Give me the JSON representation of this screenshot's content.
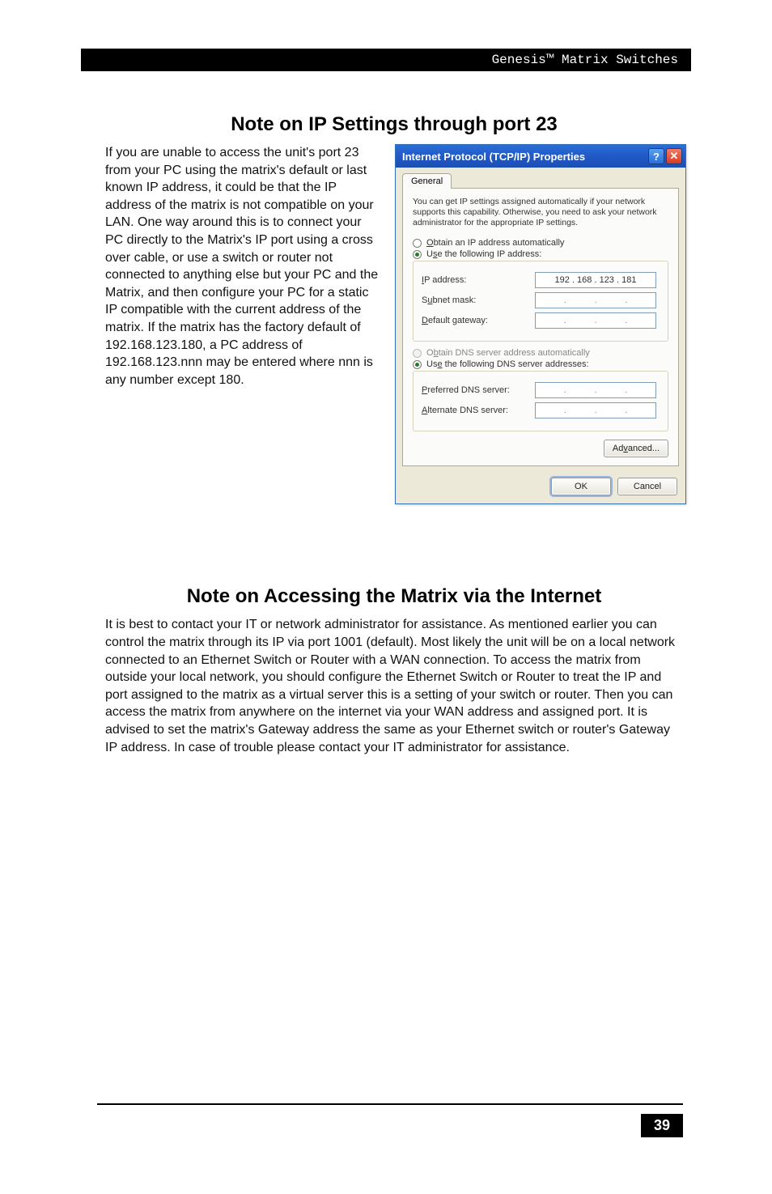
{
  "header": {
    "title": "Genesis™ Matrix Switches"
  },
  "section1": {
    "heading": "Note on IP Settings through port 23",
    "body": "If you are unable to access the unit's port 23 from your PC using the matrix's default or last known IP address, it could be that the IP address of the matrix is not compatible on your LAN. One way around this is to connect your PC directly to the Matrix's IP port using a cross over cable, or use a switch or router not connected to anything else but your PC and the Matrix, and then configure your PC for a static IP compatible with the current address of the matrix. If the matrix has the factory default of 192.168.123.180, a PC address of 192.168.123.nnn may be entered where nnn is any number except 180."
  },
  "section2": {
    "heading": "Note on Accessing the Matrix via the Internet",
    "body": "It is best to contact your IT or network administrator for assistance. As mentioned earlier you can control the matrix through its IP via port 1001 (default). Most likely the unit will be on a local network connected to an Ethernet Switch or Router with a WAN connection. To access the matrix from outside your local network, you should configure the Ethernet Switch or Router to treat the IP and port assigned to the matrix as a virtual server this is a setting of your switch or router. Then you can access the matrix from anywhere on the internet via your WAN address and assigned port. It is advised to set the matrix's Gateway address the same as your Ethernet switch or router's Gateway IP address. In case of trouble please contact your IT administrator for assistance."
  },
  "dialog": {
    "title": "Internet Protocol (TCP/IP) Properties",
    "tab": "General",
    "intro": "You can get IP settings assigned automatically if your network supports this capability. Otherwise, you need to ask your network administrator for the appropriate IP settings.",
    "ipgroup": {
      "radio_auto": "Obtain an IP address automatically",
      "radio_manual": "Use the following IP address:",
      "ip_label": "IP address:",
      "ip_value": "192 . 168 . 123 . 181",
      "subnet_label": "Subnet mask:",
      "gateway_label": "Default gateway:"
    },
    "dnsgroup": {
      "radio_auto": "Obtain DNS server address automatically",
      "radio_manual": "Use the following DNS server addresses:",
      "preferred_label": "Preferred DNS server:",
      "alternate_label": "Alternate DNS server:"
    },
    "advanced_label": "Advanced...",
    "ok_label": "OK",
    "cancel_label": "Cancel"
  },
  "page_number": "39"
}
